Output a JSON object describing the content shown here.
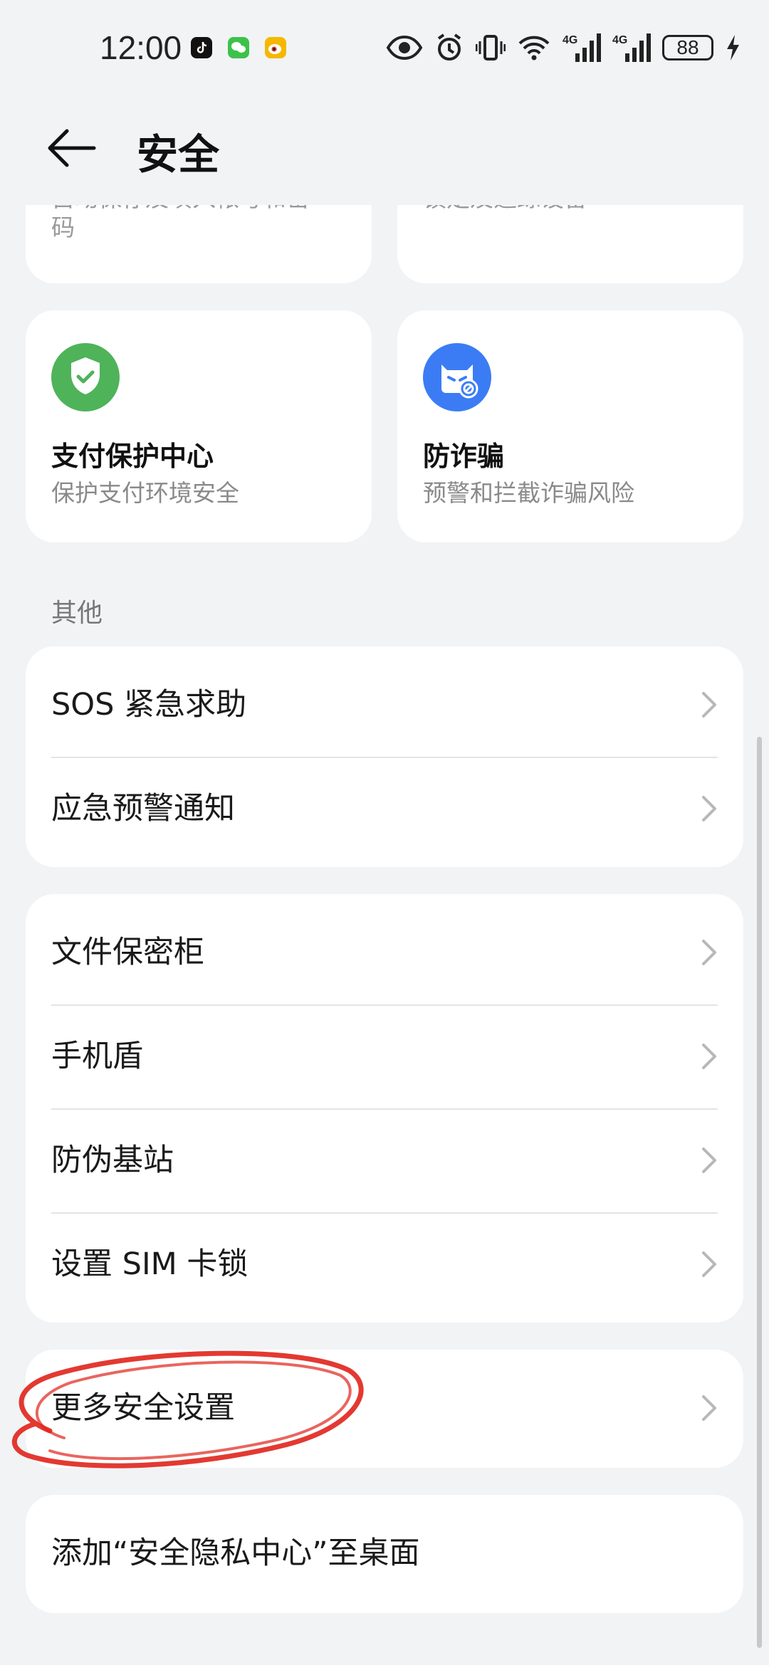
{
  "status_bar": {
    "time": "12:00",
    "battery": "88",
    "network_1": "4G",
    "network_2": "4G",
    "apps": [
      "tiktok-icon",
      "wechat-icon",
      "weibo-icon"
    ]
  },
  "header": {
    "title": "安全"
  },
  "top_tiles": [
    {
      "subtitle": "自动保存及填入帐号和密\n码"
    },
    {
      "subtitle": "锁定及追踪设备"
    }
  ],
  "tiles": [
    {
      "title": "支付保护中心",
      "subtitle": "保护支付环境安全",
      "icon": "shield-check-icon",
      "icon_color": "#4fb35a"
    },
    {
      "title": "防诈骗",
      "subtitle": "预警和拦截诈骗风险",
      "icon": "anti-fraud-icon",
      "icon_color": "#3b7cf5"
    }
  ],
  "section_other": {
    "label": "其他"
  },
  "group1": [
    {
      "label": "SOS 紧急求助"
    },
    {
      "label": "应急预警通知"
    }
  ],
  "group2": [
    {
      "label": "文件保密柜"
    },
    {
      "label": "手机盾"
    },
    {
      "label": "防伪基站"
    },
    {
      "label": "设置 SIM 卡锁"
    }
  ],
  "group3": [
    {
      "label": "更多安全设置"
    }
  ],
  "group4": [
    {
      "label": "添加“安全隐私中心”至桌面"
    }
  ],
  "colors": {
    "background": "#f1f3f5",
    "card": "#ffffff",
    "annotation": "#e0241b"
  }
}
